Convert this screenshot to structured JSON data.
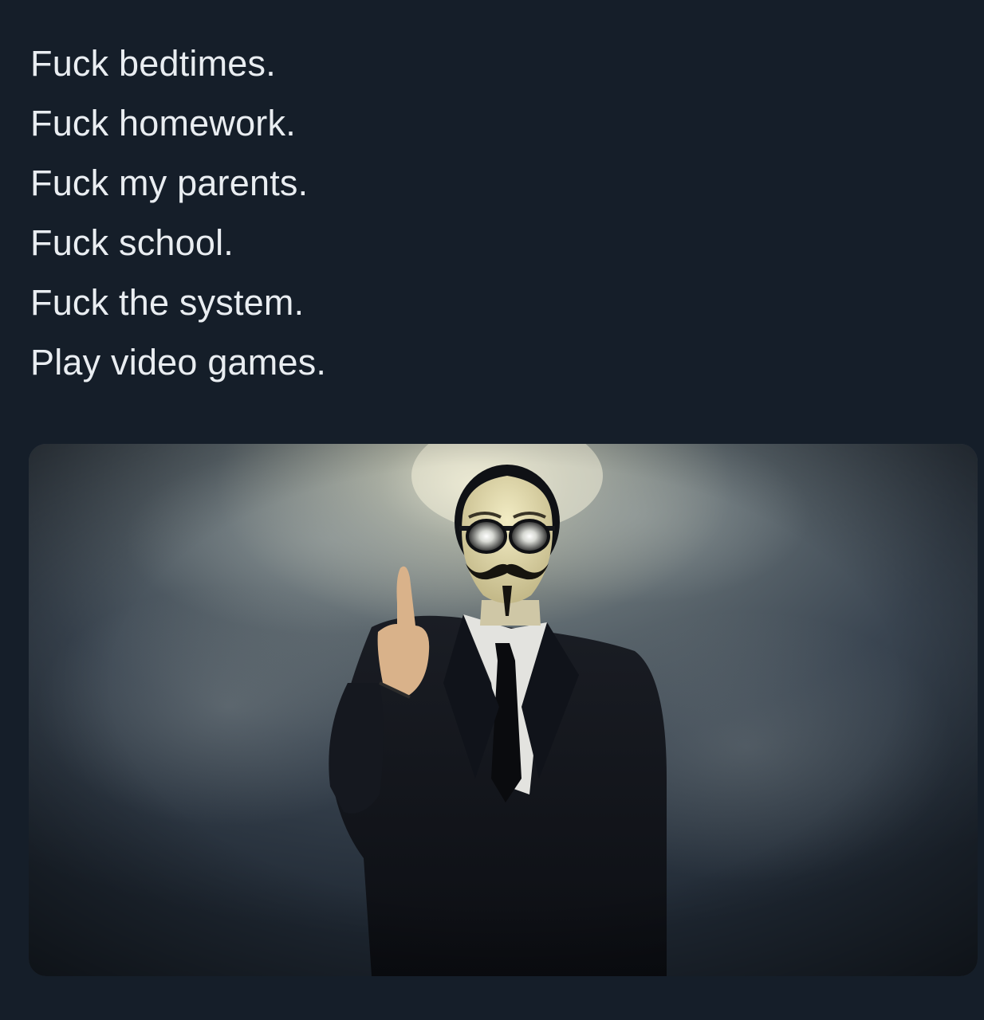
{
  "post": {
    "lines": [
      "Fuck bedtimes.",
      "Fuck homework.",
      "Fuck my parents.",
      "Fuck school.",
      "Fuck the system.",
      "Play video games."
    ]
  },
  "media": {
    "alt": "Person in a black suit wearing a Guy Fawkes mask and sunglasses raising a middle finger against a smoky dark background"
  },
  "colors": {
    "background": "#151e29",
    "text": "#e9edf1"
  }
}
